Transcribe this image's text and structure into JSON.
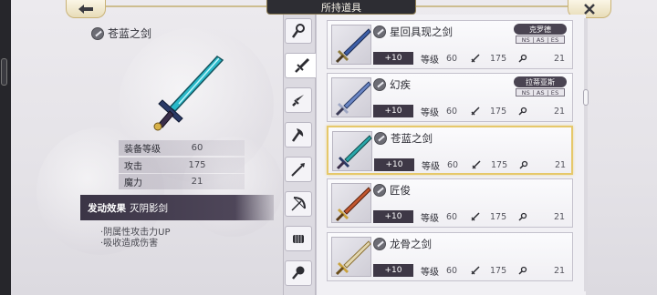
{
  "header": {
    "title": "所持道具",
    "back_icon": "arrow-left-icon",
    "close_icon": "close-x-icon"
  },
  "detail": {
    "name": "苍蓝之剑",
    "stats": [
      {
        "label": "装备等级",
        "value": "60"
      },
      {
        "label": "攻击",
        "value": "175"
      },
      {
        "label": "魔力",
        "value": "21"
      }
    ],
    "effect_label": "发动效果",
    "effect_name": "灭阴影剑",
    "effect_lines": [
      "·阴属性攻击力UP",
      "·吸收造成伤害"
    ]
  },
  "tabs": [
    {
      "icon": "staff-icon"
    },
    {
      "icon": "sword-icon",
      "active": true
    },
    {
      "icon": "dagger-icon"
    },
    {
      "icon": "axe-icon"
    },
    {
      "icon": "spear-icon"
    },
    {
      "icon": "bow-icon"
    },
    {
      "icon": "fist-icon"
    },
    {
      "icon": "mace-icon"
    }
  ],
  "items": [
    {
      "name": "星回具现之剑",
      "plus": "+10",
      "level_label": "等级",
      "level": "60",
      "atk": "175",
      "mag": "21",
      "character": "克罗德",
      "tags": "NS | AS | ES",
      "color": "#3d5fa8"
    },
    {
      "name": "幻疾",
      "plus": "+10",
      "level_label": "等级",
      "level": "60",
      "atk": "175",
      "mag": "21",
      "character": "拉蒂亚斯",
      "tags": "NS | AS | ES",
      "color": "#6a86c4"
    },
    {
      "name": "苍蓝之剑",
      "plus": "+10",
      "level_label": "等级",
      "level": "60",
      "atk": "175",
      "mag": "21",
      "character": "",
      "tags": "",
      "color": "#2aa6a8",
      "selected": true
    },
    {
      "name": "匠俊",
      "plus": "+10",
      "level_label": "等级",
      "level": "60",
      "atk": "175",
      "mag": "21",
      "character": "",
      "tags": "",
      "color": "#c2562e"
    },
    {
      "name": "龙骨之剑",
      "plus": "+10",
      "level_label": "等级",
      "level": "60",
      "atk": "175",
      "mag": "21",
      "character": "",
      "tags": "",
      "color": "#c9a23c"
    }
  ],
  "colors": {
    "accent_gold": "#e6c86a",
    "dark_label": "#3e3846",
    "header_bg": "#2d2d33"
  }
}
